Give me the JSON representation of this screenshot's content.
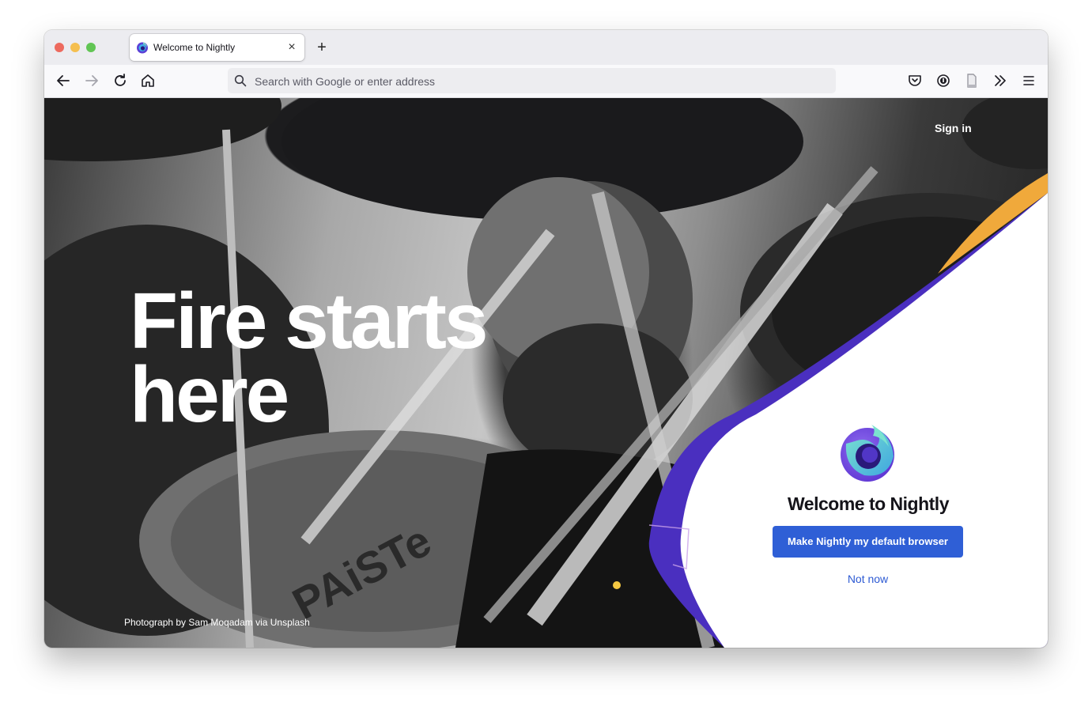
{
  "browser": {
    "tab": {
      "title": "Welcome to Nightly",
      "close_glyph": "×"
    },
    "new_tab_glyph": "+",
    "urlbar": {
      "placeholder": "Search with Google or enter address"
    },
    "icons": {
      "back": "back-arrow-icon",
      "forward": "forward-arrow-icon",
      "reload": "reload-icon",
      "home": "home-icon",
      "pocket": "pocket-icon",
      "extension": "password-manager-icon",
      "reader": "reader-view-icon",
      "overflow": "chevron-double-right-icon",
      "menu": "hamburger-menu-icon"
    }
  },
  "page": {
    "sign_in": "Sign in",
    "headline_line1": "Fire starts",
    "headline_line2": "here",
    "photo_credit": "Photograph by Sam Moqadam via Unsplash",
    "cymbal_text": "PAiSTe",
    "welcome": {
      "title": "Welcome to Nightly",
      "primary_button": "Make Nightly my default browser",
      "secondary_button": "Not now"
    }
  },
  "colors": {
    "accent_orange": "#f0a93b",
    "accent_purple": "#4a2fbf",
    "primary_blue": "#2f5fd6",
    "link_blue": "#2d5ad3",
    "dot_yellow": "#f5c842"
  }
}
